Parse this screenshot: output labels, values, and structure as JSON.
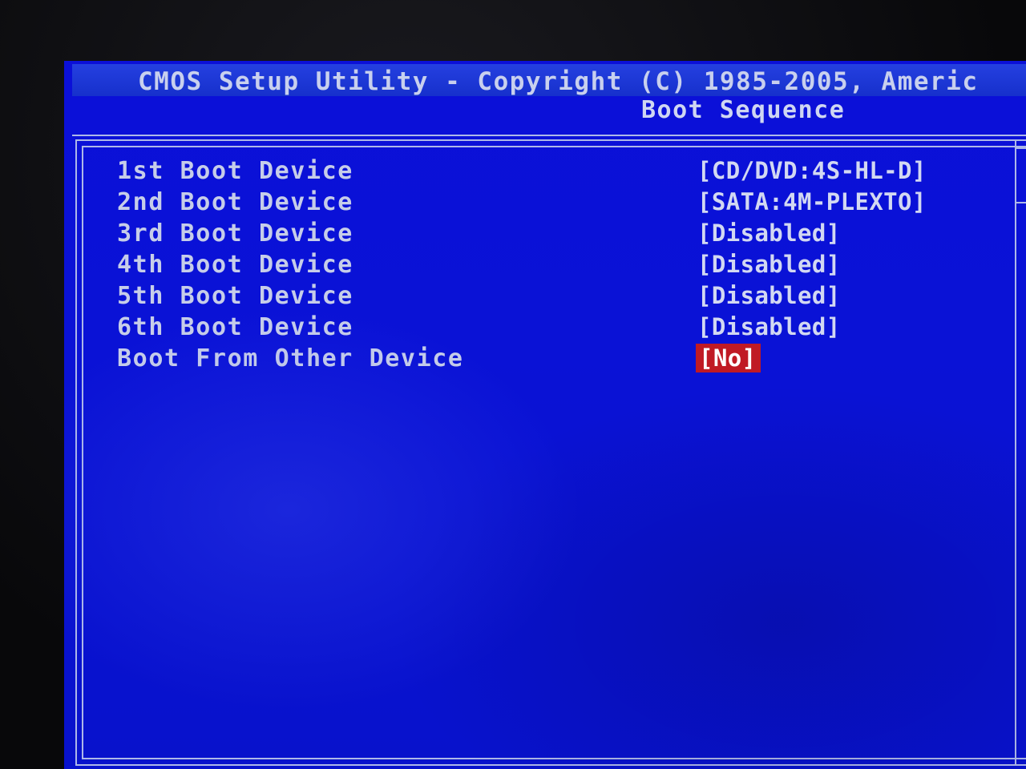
{
  "header": {
    "title": "CMOS Setup Utility - Copyright (C) 1985-2005, Americ",
    "section": "Boot Sequence"
  },
  "boot_items": [
    {
      "label": "1st Boot Device",
      "value": "[CD/DVD:4S-HL-D]"
    },
    {
      "label": "2nd Boot Device",
      "value": "[SATA:4M-PLEXTO]"
    },
    {
      "label": "3rd Boot Device",
      "value": "[Disabled]"
    },
    {
      "label": "4th Boot Device",
      "value": "[Disabled]"
    },
    {
      "label": "5th Boot Device",
      "value": "[Disabled]"
    },
    {
      "label": "6th Boot Device",
      "value": "[Disabled]"
    },
    {
      "label": "Boot From Other Device",
      "value": "[No]",
      "selected": true
    }
  ],
  "colors": {
    "background": "#0a12d6",
    "text": "#c6cde9",
    "highlight": "#c01a24"
  }
}
